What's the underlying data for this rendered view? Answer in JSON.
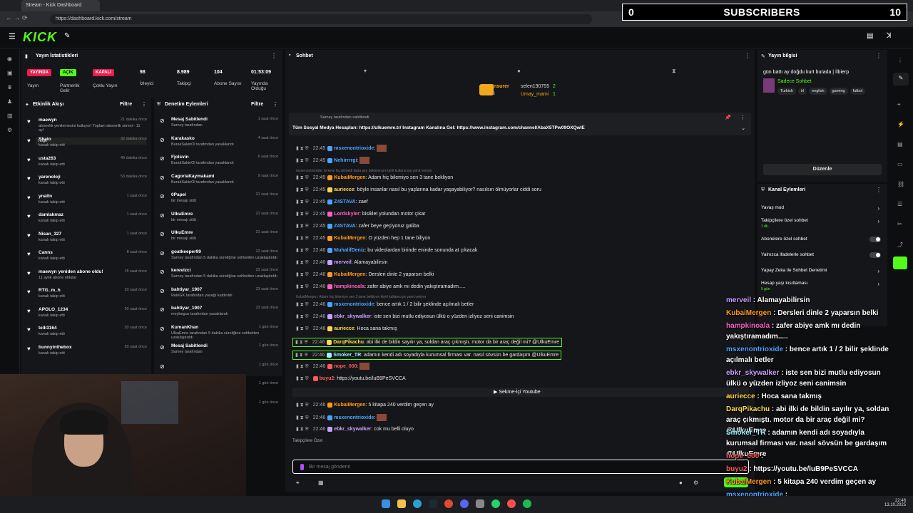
{
  "browser": {
    "tab_title": "Stream - Kick Dashboard",
    "url": "https://dashboard.kick.com/stream"
  },
  "overlay_sub": {
    "count": "0",
    "label": "SUBSCRIBERS",
    "goal": "10"
  },
  "logo": "KICK",
  "stats": {
    "title": "Yayın İstatistikleri",
    "badges": [
      {
        "text": "YAYINDA",
        "sub": "Yayın",
        "color": "#e91e4d"
      },
      {
        "text": "AÇIK",
        "sub": "Partnerlik Gelir",
        "color": "#53fc18"
      },
      {
        "text": "KAPALI",
        "sub": "Çoklu Yayın",
        "color": "#e91e4d"
      }
    ],
    "numbers": [
      {
        "v": "98",
        "l": "İzleyici"
      },
      {
        "v": "8.989",
        "l": "Takipçi"
      },
      {
        "v": "104",
        "l": "Abone Sayısı"
      },
      {
        "v": "01:53:09",
        "l": "Yayında Olduğu"
      }
    ]
  },
  "activity": {
    "title": "Etkinlik Akışı",
    "filter": "Filtre",
    "items": [
      {
        "name": "maewyn",
        "time": "21 dakika önce",
        "desc": "abonelik yenilemesini kutluyor! Toplam abonelik süresi - 11 ay!",
        "extra": "höğk"
      },
      {
        "name": "Shalo",
        "time": "32 dakika önce",
        "desc": "kanalı takip etti"
      },
      {
        "name": "usta263",
        "time": "49 dakika önce",
        "desc": "kanalı takip etti"
      },
      {
        "name": "yarenoloji",
        "time": "53 dakika önce",
        "desc": "kanalı takip etti"
      },
      {
        "name": "ynaltn",
        "time": "1 saat önce",
        "desc": "kanalı takip etti"
      },
      {
        "name": "damlakmaz",
        "time": "1 saat önce",
        "desc": "kanalı takip etti"
      },
      {
        "name": "Nisan_327",
        "time": "1 saat önce",
        "desc": "kanalı takip etti"
      },
      {
        "name": "Canns",
        "time": "8 saat önce",
        "desc": "kanalı takip etti"
      },
      {
        "name": "maewyn yeniden abone oldu!",
        "time": "15 saat önce",
        "desc": "11 aylık abone oldular"
      },
      {
        "name": "RTG_m_h",
        "time": "20 saat önce",
        "desc": "kanalı takip etti"
      },
      {
        "name": "APOLO_1234",
        "time": "20 saat önce",
        "desc": "kanalı takip etti"
      },
      {
        "name": "telli3164",
        "time": "20 saat önce",
        "desc": "kanalı takip etti"
      },
      {
        "name": "bunnyinthebox",
        "time": "20 saat önce",
        "desc": "kanalı takip etti"
      }
    ]
  },
  "moderation": {
    "title": "Denetim Eylemleri",
    "filter": "Filtre",
    "items": [
      {
        "name": "Mesaj Sabitlendi",
        "time": "1 saat önce",
        "desc": "Sarney tarafından"
      },
      {
        "name": "Karakasko",
        "time": "4 saat önce",
        "desc": "BurakSakinOl tarafından yasaklandı"
      },
      {
        "name": "Fjolsvin",
        "time": "6 saat önce",
        "desc": "BurakSakinOl tarafından yasaklandı"
      },
      {
        "name": "CagoriaKaymakami",
        "time": "9 saat önce",
        "desc": "BurakSakinOl tarafından yasaklandı"
      },
      {
        "name": "0Papel",
        "time": "21 saat önce",
        "desc": "bir mesajı sildi"
      },
      {
        "name": "UlkuEmre",
        "time": "21 saat önce",
        "desc": "bir mesajı sildi"
      },
      {
        "name": "UlkuEmre",
        "time": "21 saat önce",
        "desc": "bir mesajı sildi"
      },
      {
        "name": "goatkeeper99",
        "time": "22 saat önce",
        "desc": "Sarney tarafından 5 dakika süreliğine sohbetten uzaklaştırıldı"
      },
      {
        "name": "kerevizci",
        "time": "23 saat önce",
        "desc": "Sarney tarafından 5 dakika süreliğine sohbetten uzaklaştırıldı"
      },
      {
        "name": "bahtiyar_1907",
        "time": "23 saat önce",
        "desc": "RelnGK tarafından yasağı kaldırıldı"
      },
      {
        "name": "bahtiyar_1907",
        "time": "23 saat önce",
        "desc": "meybegus tarafından yasaklandı"
      },
      {
        "name": "KumanKhan",
        "time": "1 gün önce",
        "desc": "UlkuEmre tarafından 5 dakika süreliğine sohbetten uzaklaştırıldı"
      },
      {
        "name": "Mesaj Sabitlendi",
        "time": "1 gün önce",
        "desc": "Sarney tarafından"
      },
      {
        "name": "",
        "time": "1 gün önce",
        "desc": ""
      },
      {
        "name": "",
        "time": "1 gün önce",
        "desc": ""
      },
      {
        "name": "",
        "time": "1 gün önce",
        "desc": ""
      }
    ]
  },
  "chat": {
    "title": "Sohbet",
    "top_gifters": [
      {
        "name": "Insurer",
        "n": "5"
      },
      {
        "name": "selen190755",
        "n": "2"
      },
      {
        "name": "Umay_mami",
        "n": "1"
      }
    ],
    "pinned_by": "Sarney tarafından sabitlendi",
    "pinned_text": "Tüm Sosyal Medya Hesapları: https://ulkuemre.tr/ Instagram Kanalına Gel: https://www.instagram.com/channel/AbaX5TPw09OXQwIE",
    "lines": [
      {
        "time": "22:45",
        "user": "msxenontrioxide",
        "color": "#4da3ff",
        "msg": ""
      },
      {
        "time": "22:45",
        "user": "Nehirrrrgi",
        "color": "#4da3ff",
        "msg": ""
      },
      {
        "time": "",
        "user": "",
        "color": "#888",
        "msg": "msxenontrioxide: bi kere hiç bilmedi fazla şey bekliyorum kimli kullanıcıya yanıt veriyor"
      },
      {
        "time": "22:45",
        "user": "KubaiMergen",
        "color": "#ff9a1f",
        "msg": "Adam hiç bilemiyo sen 3 tane bekliyon"
      },
      {
        "time": "22:45",
        "user": "auriecce",
        "color": "#ffd94d",
        "msg": "böyle insanlar nasıl bu yaşlarına kadar yaşayabiliyor? nasılsın ölmüyorlar ciddi soru"
      },
      {
        "time": "22:45",
        "user": "Z4STAVA",
        "color": "#4da3ff",
        "msg": "zaef"
      },
      {
        "time": "22:45",
        "user": "Lordskyler",
        "color": "#ff5fc4",
        "msg": "bisiklet yolundan motor çıkar"
      },
      {
        "time": "22:45",
        "user": "Z4STAVA",
        "color": "#4da3ff",
        "msg": "zafer beye geçiyoruz galiba"
      },
      {
        "time": "22:45",
        "user": "KubaiMergen",
        "color": "#ff9a1f",
        "msg": "O yüzden hep 1 tane biliyon"
      },
      {
        "time": "22:46",
        "user": "MuhalifDeniz",
        "color": "#4da3ff",
        "msg": "bu videolardan birinde eninde sonunda at çıkacak"
      },
      {
        "time": "22:46",
        "user": "merveil",
        "color": "#c8a0ff",
        "msg": "Alamayabilirsin"
      },
      {
        "time": "22:46",
        "user": "KubaiMergen",
        "color": "#ff9a1f",
        "msg": "Dersleri dinle 2 yaparsın belki"
      },
      {
        "time": "22:46",
        "user": "hampkinoala",
        "color": "#ff5fc4",
        "msg": "zafer abiye amk mı dedin yakıştıramadım....."
      },
      {
        "time": "",
        "user": "",
        "color": "#888",
        "msg": "KubaiMergen: Adam hiç bilemiyo sen 3 tane bekliyon kimli kullanıcıya yanıt veriyor"
      },
      {
        "time": "22:46",
        "user": "msxenontrioxide",
        "color": "#4da3ff",
        "msg": "bence artık 1 / 2 bilir şeklinde açılmalı betler"
      },
      {
        "time": "22:46",
        "user": "ebkr_skywalker",
        "color": "#c8a0ff",
        "msg": "iste sen bizi mutlu ediyosun ülkü o yüzden izliyoz seni canimsin"
      },
      {
        "time": "22:46",
        "user": "auriecce",
        "color": "#ffd94d",
        "msg": "Hoca sana takmış"
      },
      {
        "time": "22:46",
        "user": "DarqPikachu",
        "color": "#ffd94d",
        "msg": "abi ilki de bildin sayılır ya, soldan araç çıkmıştı. motor da bir araç değil mi? @UlkuEmre"
      },
      {
        "time": "22:46",
        "user": "Smoker_TR",
        "color": "#a0f0ff",
        "msg": "adamın kendi adı soyadıyla kurumsal firması var. nasıl sövsün be gardaşım @UlkuEmre"
      },
      {
        "time": "22:46",
        "user": "nope_000",
        "color": "#ff5a5a",
        "msg": ""
      },
      {
        "time": "",
        "user": "buyu2",
        "color": "#ff5a5a",
        "msg": "https://youtu.be/luB9PeSVCCA"
      },
      {
        "time": "22:46",
        "user": "KubaiMergen",
        "color": "#ff9a1f",
        "msg": "5 kitapa 240 verdim geçen ay"
      },
      {
        "time": "22:46",
        "user": "msxenontrioxide",
        "color": "#4da3ff",
        "msg": ""
      },
      {
        "time": "22:46",
        "user": "ebkr_skywalker",
        "color": "#c8a0ff",
        "msg": "cok mu belli oluyo"
      }
    ],
    "youtube_label": "Sekme-İçi Youtube",
    "followers_label": "Takipçilere Özel",
    "input_placeholder": "Bir mesaj gönderin"
  },
  "stream_info": {
    "title": "Yayın bilgisi",
    "stream_title": "gün battı ay doğdu kurt burada | İlbierp",
    "category": "Sadece Sohbet",
    "tags": [
      "Turkish",
      "irl",
      "english",
      "gaming",
      "futbol"
    ],
    "edit": "Düzenle"
  },
  "channel_actions": {
    "title": "Kanal Eylemleri",
    "items": [
      {
        "label": "Yavaş mod",
        "sub": ""
      },
      {
        "label": "Takipçilere özel sohbet",
        "sub": "1 dk."
      },
      {
        "label": "Abonelere özel sohbet",
        "sub": ""
      },
      {
        "label": "Yalnızca ifadelerle sohbet",
        "sub": ""
      },
      {
        "label": "Yapay Zeka ile Sohbet Denetimi",
        "sub": ""
      },
      {
        "label": "Hesap yaşı kısıtlaması",
        "sub": "5 gün"
      }
    ]
  },
  "overlay_chat": [
    {
      "user": "merveil",
      "color": "#c8a0ff",
      "msg": "Alamayabilirsin"
    },
    {
      "user": "KubaiMergen",
      "color": "#ff9a1f",
      "msg": "Dersleri dinle 2 yaparsın belki"
    },
    {
      "user": "hampkinoala",
      "color": "#ff5fc4",
      "msg": "zafer abiye amk mı dedin yakıştıramadım....."
    },
    {
      "user": "msxenontrioxide",
      "color": "#4da3ff",
      "msg": "bence artık 1 / 2 bilir şeklinde açılmalı betler"
    },
    {
      "user": "ebkr_skywalker",
      "color": "#c8a0ff",
      "msg": "iste sen bizi mutlu ediyosun ülkü o yüzden izliyoz seni canimsin"
    },
    {
      "user": "auriecce",
      "color": "#ffd94d",
      "msg": "Hoca sana takmış"
    },
    {
      "user": "DarqPikachu",
      "color": "#ffd94d",
      "msg": "abi ilki de bildin sayılır ya, soldan araç çıkmıştı. motor da bir araç değil mi? @UlkuEmre"
    },
    {
      "user": "Smoker_TR",
      "color": "#a0f0ff",
      "msg": "adamın kendi adı soyadıyla kurumsal firması var. nasıl sövsün be gardaşım @UlkuEmre"
    },
    {
      "user": "nope_000",
      "color": "#ff5a5a",
      "msg": ""
    },
    {
      "user": "buyu2",
      "color": "#ff5a5a",
      "msg": "https://youtu.be/luB9PeSVCCA"
    },
    {
      "user": "KubaiMergen",
      "color": "#ff9a1f",
      "msg": "5 kitapa 240 verdim geçen ay"
    },
    {
      "user": "msxenontrioxide",
      "color": "#4da3ff",
      "msg": ""
    },
    {
      "user": "ebkr_skywalker",
      "color": "#c8a0ff",
      "msg": "cok mu belli oluyo"
    }
  ],
  "taskbar": {
    "time": "22:46",
    "date": "13.10.2025"
  }
}
